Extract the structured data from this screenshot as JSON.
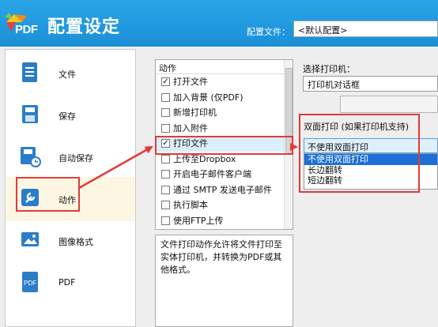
{
  "header": {
    "logo_text": "PDF",
    "title": "配置设定",
    "profile_label": "配置文件：",
    "profile_value": "<默认配置>"
  },
  "sidebar": {
    "items": [
      {
        "label": "文件",
        "icon": "file-icon"
      },
      {
        "label": "保存",
        "icon": "save-icon"
      },
      {
        "label": "自动保存",
        "icon": "autosave-icon"
      },
      {
        "label": "动作",
        "icon": "wrench-icon",
        "active": true
      },
      {
        "label": "图像格式",
        "icon": "image-icon"
      },
      {
        "label": "PDF",
        "icon": "pdf-icon"
      }
    ]
  },
  "actions": {
    "header": "动作",
    "items": [
      {
        "label": "打开文件",
        "checked": true
      },
      {
        "label": "加入背景 (仅PDF)",
        "checked": false
      },
      {
        "label": "新增打印机",
        "checked": false
      },
      {
        "label": "加入附件",
        "checked": false
      },
      {
        "label": "打印文件",
        "checked": true,
        "selected": true
      },
      {
        "label": "上传至Dropbox",
        "checked": false
      },
      {
        "label": "开启电子邮件客户端",
        "checked": false
      },
      {
        "label": "通过 SMTP 发送电子邮件",
        "checked": false
      },
      {
        "label": "执行脚本",
        "checked": false
      },
      {
        "label": "使用FTP上传",
        "checked": false
      }
    ],
    "description": "文件打印动作允许将文件打印至实体打印机，并转换为PDF或其他格式。"
  },
  "printer": {
    "select_label": "选择打印机：",
    "select_value": "打印机对话框",
    "duplex_label": "双面打印 (如果打印机支持)",
    "duplex_value": "不使用双面打印",
    "duplex_options": [
      "不使用双面打印",
      "长边翻转",
      "短边翻转"
    ]
  },
  "colors": {
    "header_blue": "#1b8fd6",
    "highlight_red": "#e53935",
    "selected_blue": "#1c6fd4"
  }
}
